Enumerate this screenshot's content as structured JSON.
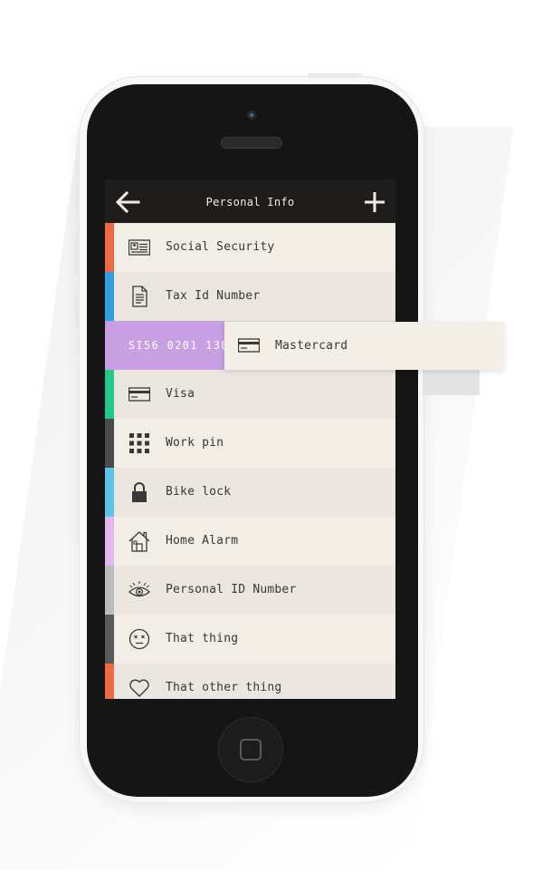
{
  "header": {
    "back_icon": "arrow-left-icon",
    "title": "Personal Info",
    "add_icon": "plus-icon"
  },
  "colors": {
    "bg_odd": "#f2ede5",
    "bg_even": "#ebe6df",
    "text": "#3a3836",
    "swipe": "#c79fe2"
  },
  "items": [
    {
      "label": "Social Security",
      "icon": "id-card-icon",
      "color": "#f06a43"
    },
    {
      "label": "Tax Id Number",
      "icon": "document-icon",
      "color": "#2f9fe0"
    },
    {
      "label": "Visa",
      "icon": "credit-card-icon",
      "color": "#22c98a"
    },
    {
      "label": "Work pin",
      "icon": "keypad-icon",
      "color": "#4b4b4b"
    },
    {
      "label": "Bike lock",
      "icon": "padlock-icon",
      "color": "#5dc4e8"
    },
    {
      "label": "Home Alarm",
      "icon": "house-icon",
      "color": "#e3b8ef"
    },
    {
      "label": "Personal ID Number",
      "icon": "eye-icon",
      "color": "#bcbcbc"
    },
    {
      "label": "That thing",
      "icon": "dizzy-face-icon",
      "color": "#5a5a5a"
    },
    {
      "label": "That other thing",
      "icon": "heart-icon",
      "color": "#f06a43"
    }
  ],
  "swiped": {
    "value_text": "SI56 0201 130"
  },
  "dragging": {
    "label": "Mastercard",
    "icon": "credit-card-icon"
  }
}
